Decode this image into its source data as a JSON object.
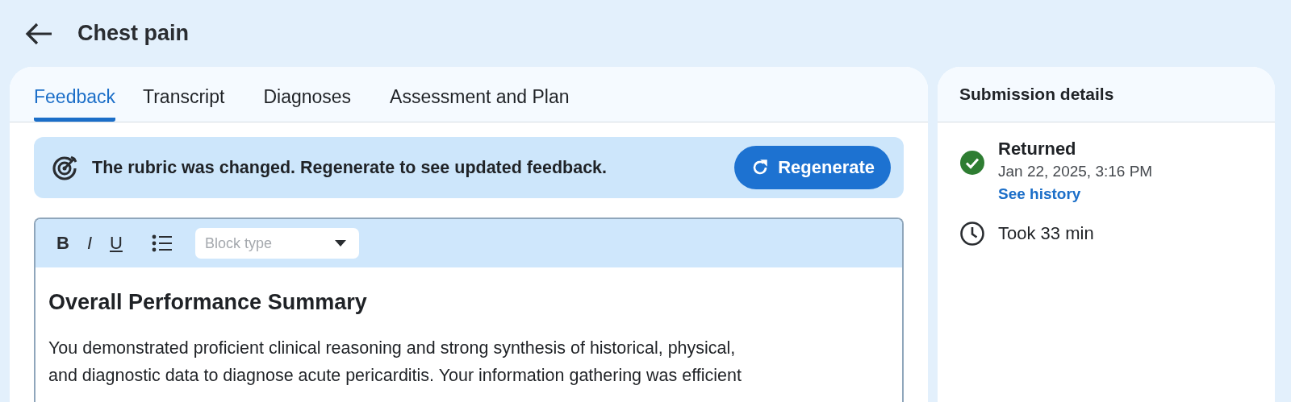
{
  "header": {
    "title": "Chest pain"
  },
  "tabs": [
    {
      "label": "Feedback",
      "selected": true
    },
    {
      "label": "Transcript",
      "selected": false
    },
    {
      "label": "Diagnoses",
      "selected": false
    },
    {
      "label": "Assessment and Plan",
      "selected": false
    }
  ],
  "banner": {
    "message": "The rubric was changed. Regenerate to see updated feedback.",
    "button": "Regenerate"
  },
  "editor": {
    "toolbar": [
      {
        "kind": "bold",
        "label": "B"
      },
      {
        "kind": "italic",
        "label": "I"
      },
      {
        "kind": "underline",
        "label": "U"
      },
      {
        "kind": "list"
      }
    ],
    "block_type": {
      "placeholder": "Block type"
    },
    "heading": "Overall Performance Summary",
    "paragraph_lines": [
      "You demonstrated proficient clinical reasoning and strong synthesis of historical, physical,",
      "and diagnostic data to diagnose acute pericarditis. Your information gathering was efficient"
    ]
  },
  "submission_details": {
    "title": "Submission details",
    "items": [
      {
        "kind": "status",
        "label": "Returned",
        "date": "Jan 22, 2025, 3:16 PM",
        "link": "See history"
      },
      {
        "kind": "duration",
        "label": "Took 33 min"
      }
    ]
  }
}
